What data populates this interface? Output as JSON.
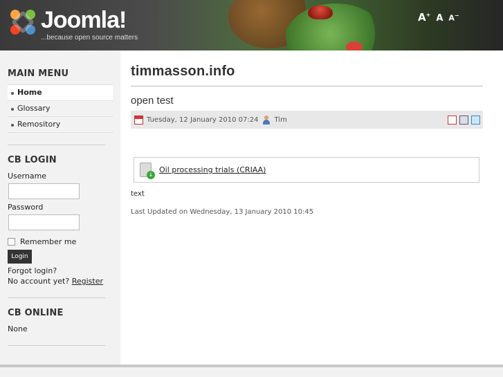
{
  "header": {
    "logo_word": "Joomla!",
    "logo_tagline": "...because open source matters",
    "font_size_controls": {
      "increase": "A",
      "reset": "A",
      "decrease": "A"
    }
  },
  "sidebar": {
    "main_menu": {
      "title": "MAIN MENU",
      "items": [
        {
          "label": "Home",
          "active": true
        },
        {
          "label": "Glossary",
          "active": false
        },
        {
          "label": "Remository",
          "active": false
        }
      ]
    },
    "cb_login": {
      "title": "CB LOGIN",
      "username_label": "Username",
      "username_value": "",
      "password_label": "Password",
      "password_value": "",
      "remember_label": "Remember me",
      "login_button": "Login",
      "forgot_login": "Forgot login?",
      "no_account_text": "No account yet?",
      "register_link": "Register"
    },
    "cb_online": {
      "title": "CB ONLINE",
      "status": "None"
    }
  },
  "main": {
    "site_title": "timmasson.info",
    "article": {
      "title": "open test",
      "date": "Tuesday, 12 January 2010 07:24",
      "author": "Tim",
      "attachment_label": "Oil processing trials (CRIAA)",
      "body_text": "text",
      "last_updated": "Last Updated on Wednesday, 13 January 2010 10:45"
    }
  },
  "colors": {
    "sidebar_bg": "#f2f2f2",
    "header_dark": "#3a3a3a",
    "text": "#333333"
  }
}
